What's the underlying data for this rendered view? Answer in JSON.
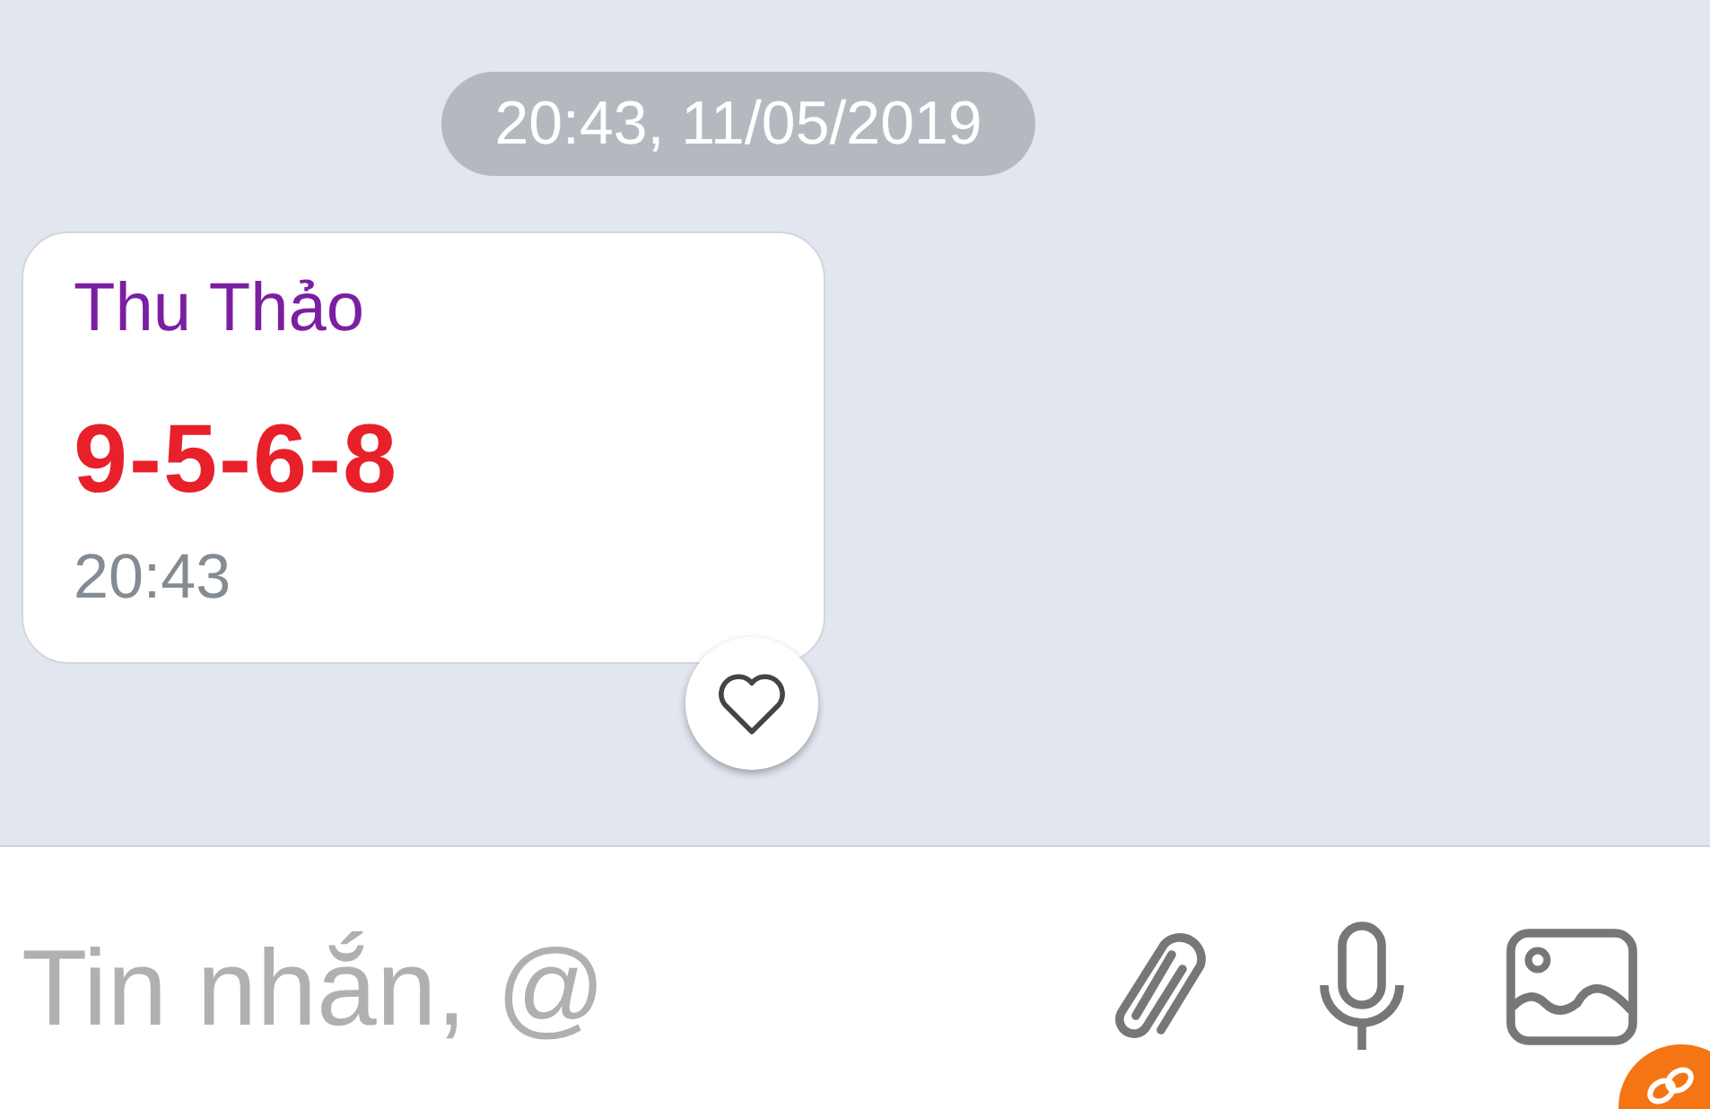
{
  "date_divider": "20:43, 11/05/2019",
  "messages": [
    {
      "sender": "Thu Thảo",
      "text": "9-5-6-8",
      "time": "20:43",
      "liked": false
    }
  ],
  "composer": {
    "placeholder": "Tin nhắn, @"
  }
}
